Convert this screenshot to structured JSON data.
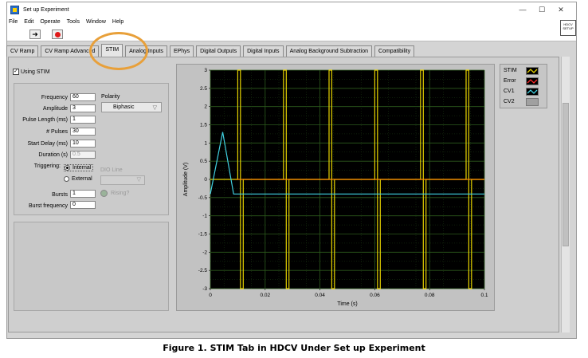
{
  "window": {
    "title": "Set up Experiment",
    "min": "—",
    "max": "☐",
    "close": "✕"
  },
  "menu": [
    "File",
    "Edit",
    "Operate",
    "Tools",
    "Window",
    "Help"
  ],
  "toolbar": {
    "run": "➜"
  },
  "vi_icon_text": "HDCV SETUP",
  "tabs": [
    "CV Ramp",
    "CV Ramp Advanced",
    "STIM",
    "Analog Inputs",
    "EPhys",
    "Digital Outputs",
    "Digital Inputs",
    "Analog Background Subtraction",
    "Compatibility"
  ],
  "active_tab": "STIM",
  "using_stim": {
    "label": "Using STIM",
    "check": "✓"
  },
  "params": {
    "frequency": {
      "label": "Frequency",
      "value": "60"
    },
    "amplitude": {
      "label": "Amplitude",
      "value": "3"
    },
    "pulse_length": {
      "label": "Pulse Length (ms)",
      "value": "1"
    },
    "pulses": {
      "label": "# Pulses",
      "value": "30"
    },
    "start_delay": {
      "label": "Start Delay (ms)",
      "value": "10"
    },
    "duration": {
      "label": "Duration (s)",
      "value": "0.5"
    },
    "bursts": {
      "label": "Bursts",
      "value": "1"
    },
    "burst_frequency": {
      "label": "Burst frequency",
      "value": "0"
    }
  },
  "polarity": {
    "label": "Polarity",
    "value": "Biphasic",
    "arrow": "▽"
  },
  "triggering": {
    "label": "Triggering:",
    "internal": "Internal",
    "external": "External"
  },
  "dio": {
    "label": "DIO Line",
    "arrow": "▽"
  },
  "rising": {
    "label": "Rising?"
  },
  "legend": [
    {
      "name": "STIM",
      "color": "#e6d200"
    },
    {
      "name": "Error",
      "color": "#ff2a2a"
    },
    {
      "name": "CV1",
      "color": "#40d0e0"
    },
    {
      "name": "CV2",
      "color": "#a0a0a0"
    }
  ],
  "chart_data": {
    "type": "line",
    "xlabel": "Time (s)",
    "ylabel": "Amplitude (V)",
    "xlim": [
      0,
      0.1
    ],
    "ylim": [
      -3,
      3
    ],
    "x_ticks": [
      "0",
      "0.02",
      "0.04",
      "0.06",
      "0.08",
      "0.1"
    ],
    "y_ticks": [
      "3",
      "2.5",
      "2",
      "1.5",
      "1",
      "0.5",
      "0",
      "-0.5",
      "-1",
      "-1.5",
      "-2",
      "-2.5",
      "-3"
    ],
    "grid": true,
    "series": [
      {
        "name": "STIM",
        "color": "#e6d200",
        "x": [
          0,
          0.01,
          0.01,
          0.011,
          0.011,
          0.012,
          0.012,
          0.0267,
          0.0267,
          0.0277,
          0.0277,
          0.0287,
          0.0287,
          0.0433,
          0.0433,
          0.0443,
          0.0443,
          0.0453,
          0.0453,
          0.06,
          0.06,
          0.061,
          0.061,
          0.062,
          0.062,
          0.0767,
          0.0767,
          0.0777,
          0.0777,
          0.0787,
          0.0787,
          0.0933,
          0.0933,
          0.0943,
          0.0943,
          0.0953,
          0.0953,
          0.1
        ],
        "y": [
          0,
          0,
          3,
          3,
          -3,
          -3,
          0,
          0,
          3,
          3,
          -3,
          -3,
          0,
          0,
          3,
          3,
          -3,
          -3,
          0,
          0,
          3,
          3,
          -3,
          -3,
          0,
          0,
          3,
          3,
          -3,
          -3,
          0,
          0,
          3,
          3,
          -3,
          -3,
          0,
          0
        ]
      },
      {
        "name": "Error",
        "color": "#ff8c00",
        "x": [
          0.0095,
          0.1
        ],
        "y": [
          0,
          0
        ]
      },
      {
        "name": "CV1",
        "color": "#40d0e0",
        "x": [
          0,
          0.0045,
          0.0085,
          0.1
        ],
        "y": [
          -0.4,
          1.3,
          -0.4,
          -0.4
        ]
      }
    ]
  },
  "caption": "Figure 1. STIM Tab in HDCV Under Set up Experiment"
}
